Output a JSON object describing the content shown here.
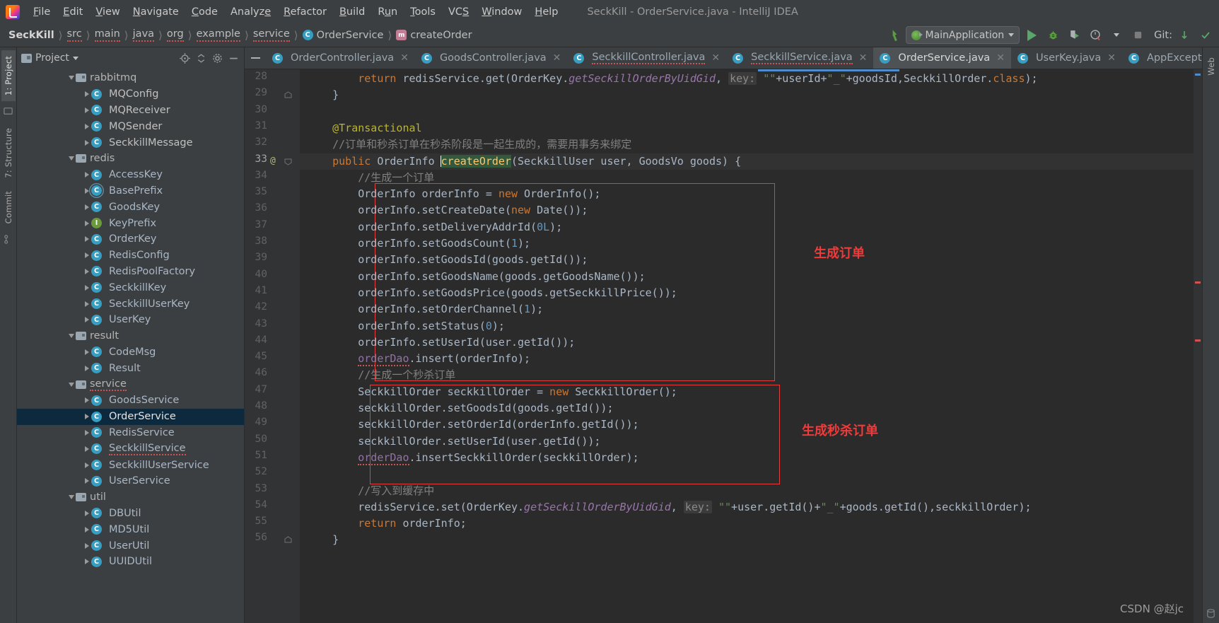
{
  "window": {
    "title": "SeckKill - OrderService.java - IntelliJ IDEA"
  },
  "menu": {
    "items": [
      {
        "label": "File"
      },
      {
        "label": "Edit"
      },
      {
        "label": "View"
      },
      {
        "label": "Navigate"
      },
      {
        "label": "Code"
      },
      {
        "label": "Analyze"
      },
      {
        "label": "Refactor"
      },
      {
        "label": "Build"
      },
      {
        "label": "Run"
      },
      {
        "label": "Tools"
      },
      {
        "label": "VCS"
      },
      {
        "label": "Window"
      },
      {
        "label": "Help"
      }
    ]
  },
  "breadcrumbs": [
    {
      "label": "SeckKill",
      "icon": "",
      "bold": true
    },
    {
      "label": "src",
      "icon": "",
      "squiggle": true
    },
    {
      "label": "main",
      "icon": "",
      "squiggle": true
    },
    {
      "label": "java",
      "icon": "",
      "squiggle": true
    },
    {
      "label": "org",
      "icon": "",
      "squiggle": true
    },
    {
      "label": "example",
      "icon": "",
      "squiggle": true
    },
    {
      "label": "service",
      "icon": "",
      "squiggle": true
    },
    {
      "label": "OrderService",
      "icon": "class-icon",
      "squiggle": false
    },
    {
      "label": "createOrder",
      "icon": "method-icon",
      "squiggle": false
    }
  ],
  "toolbar": {
    "run_configuration": "MainApplication",
    "run_button": "run-button",
    "debug_button": "debug-button",
    "run_coverage_button": "run-with-coverage-button",
    "profiler_button": "profiler-button",
    "stop_button": "stop-button",
    "git_label": "Git:"
  },
  "project_panel": {
    "title": "Project",
    "tree": [
      {
        "indent": 3,
        "arrow": "open",
        "icon": "folder",
        "label": "rabbitmq",
        "style": "folder"
      },
      {
        "indent": 4,
        "arrow": "closed",
        "icon": "class",
        "label": "MQConfig",
        "style": "plain"
      },
      {
        "indent": 4,
        "arrow": "closed",
        "icon": "class",
        "label": "MQReceiver",
        "style": "plain"
      },
      {
        "indent": 4,
        "arrow": "closed",
        "icon": "class",
        "label": "MQSender",
        "style": "plain"
      },
      {
        "indent": 4,
        "arrow": "closed",
        "icon": "class",
        "label": "SeckkillMessage",
        "style": "plain"
      },
      {
        "indent": 3,
        "arrow": "open",
        "icon": "folder",
        "label": "redis",
        "style": "folder"
      },
      {
        "indent": 4,
        "arrow": "closed",
        "icon": "class",
        "label": "AccessKey",
        "style": "code"
      },
      {
        "indent": 4,
        "arrow": "closed",
        "icon": "abstract",
        "label": "BasePrefix",
        "style": "code"
      },
      {
        "indent": 4,
        "arrow": "closed",
        "icon": "class",
        "label": "GoodsKey",
        "style": "code"
      },
      {
        "indent": 4,
        "arrow": "closed",
        "icon": "interface",
        "label": "KeyPrefix",
        "style": "code"
      },
      {
        "indent": 4,
        "arrow": "closed",
        "icon": "class",
        "label": "OrderKey",
        "style": "code"
      },
      {
        "indent": 4,
        "arrow": "closed",
        "icon": "class",
        "label": "RedisConfig",
        "style": "code"
      },
      {
        "indent": 4,
        "arrow": "closed",
        "icon": "class",
        "label": "RedisPoolFactory",
        "style": "code"
      },
      {
        "indent": 4,
        "arrow": "closed",
        "icon": "class",
        "label": "SeckkillKey",
        "style": "code"
      },
      {
        "indent": 4,
        "arrow": "closed",
        "icon": "class",
        "label": "SeckkillUserKey",
        "style": "code"
      },
      {
        "indent": 4,
        "arrow": "closed",
        "icon": "class",
        "label": "UserKey",
        "style": "code"
      },
      {
        "indent": 3,
        "arrow": "open",
        "icon": "folder",
        "label": "result",
        "style": "folder"
      },
      {
        "indent": 4,
        "arrow": "closed",
        "icon": "class",
        "label": "CodeMsg",
        "style": "code"
      },
      {
        "indent": 4,
        "arrow": "closed",
        "icon": "class",
        "label": "Result",
        "style": "code"
      },
      {
        "indent": 3,
        "arrow": "open",
        "icon": "folder",
        "label": "service",
        "style": "folder-squig"
      },
      {
        "indent": 4,
        "arrow": "closed",
        "icon": "class",
        "label": "GoodsService",
        "style": "code"
      },
      {
        "indent": 4,
        "arrow": "closed",
        "icon": "class",
        "label": "OrderService",
        "style": "white",
        "selected": true
      },
      {
        "indent": 4,
        "arrow": "closed",
        "icon": "class",
        "label": "RedisService",
        "style": "code"
      },
      {
        "indent": 4,
        "arrow": "closed",
        "icon": "class",
        "label": "SeckkillService",
        "style": "code-squig"
      },
      {
        "indent": 4,
        "arrow": "closed",
        "icon": "class",
        "label": "SeckkillUserService",
        "style": "code"
      },
      {
        "indent": 4,
        "arrow": "closed",
        "icon": "class",
        "label": "UserService",
        "style": "code"
      },
      {
        "indent": 3,
        "arrow": "open",
        "icon": "folder",
        "label": "util",
        "style": "folder"
      },
      {
        "indent": 4,
        "arrow": "closed",
        "icon": "class",
        "label": "DBUtil",
        "style": "code"
      },
      {
        "indent": 4,
        "arrow": "closed",
        "icon": "class",
        "label": "MD5Util",
        "style": "code"
      },
      {
        "indent": 4,
        "arrow": "closed",
        "icon": "class",
        "label": "UserUtil",
        "style": "code"
      },
      {
        "indent": 4,
        "arrow": "closed",
        "icon": "class",
        "label": "UUIDUtil",
        "style": "code"
      }
    ]
  },
  "left_tool_window_tabs": [
    {
      "label": "1: Project"
    },
    {
      "label": "7: Structure"
    },
    {
      "label": "Commit"
    }
  ],
  "right_tool_window_tabs": [
    {
      "label": "Web"
    }
  ],
  "editor_tabs": [
    {
      "label": "OrderController.java",
      "icon": "class-icon",
      "active": false,
      "squiggle": false
    },
    {
      "label": "GoodsController.java",
      "icon": "class-icon",
      "active": false,
      "squiggle": false
    },
    {
      "label": "SeckkillController.java",
      "icon": "class-icon",
      "active": false,
      "squiggle": true
    },
    {
      "label": "SeckkillService.java",
      "icon": "class-icon",
      "active": false,
      "squiggle": true
    },
    {
      "label": "OrderService.java",
      "icon": "class-icon",
      "active": true,
      "squiggle": false
    },
    {
      "label": "UserKey.java",
      "icon": "class-icon",
      "active": false,
      "squiggle": false
    },
    {
      "label": "AppException",
      "icon": "class-icon",
      "active": false,
      "squiggle": false
    }
  ],
  "code": {
    "first_line_number": 28,
    "current_line_number": 33,
    "lines": [
      {
        "num": 28,
        "html": "        <span class=\"k\">return</span> redisService.get(OrderKey.<span class=\"st\">getSeckillOrderByUidGid</span>, <span class=\"pm\">key:</span> <span class=\"s\">\"\"</span>+userId+<span class=\"s\">\"_\"</span>+goodsId,SeckkillOrder.<span class=\"k\">class</span>);"
      },
      {
        "num": 29,
        "html": "    }"
      },
      {
        "num": 30,
        "html": ""
      },
      {
        "num": 31,
        "html": "    <span class=\"an\">@Transactional</span>"
      },
      {
        "num": 32,
        "html": "    <span class=\"cm\">//订单和秒杀订单在秒杀阶段是一起生成的，需要用事务来绑定</span>"
      },
      {
        "num": 33,
        "html": "    <span class=\"k\">public</span> OrderInfo <span class=\"caret\"></span><span class=\"meth-hl fn\">createOrder</span>(SeckkillUser user, GoodsVo goods) {"
      },
      {
        "num": 34,
        "html": "        <span class=\"cm\">//生成一个订单</span>"
      },
      {
        "num": 35,
        "html": "        OrderInfo orderInfo = <span class=\"k\">new</span> OrderInfo();"
      },
      {
        "num": 36,
        "html": "        orderInfo.setCreateDate(<span class=\"k\">new</span> Date());"
      },
      {
        "num": 37,
        "html": "        orderInfo.setDeliveryAddrId(<span class=\"n\">0L</span>);"
      },
      {
        "num": 38,
        "html": "        orderInfo.setGoodsCount(<span class=\"n\">1</span>);"
      },
      {
        "num": 39,
        "html": "        orderInfo.setGoodsId(goods.getId());"
      },
      {
        "num": 40,
        "html": "        orderInfo.setGoodsName(goods.getGoodsName());"
      },
      {
        "num": 41,
        "html": "        orderInfo.setGoodsPrice(goods.getSeckkillPrice());"
      },
      {
        "num": 42,
        "html": "        orderInfo.setOrderChannel(<span class=\"n\">1</span>);"
      },
      {
        "num": 43,
        "html": "        orderInfo.setStatus(<span class=\"n\">0</span>);"
      },
      {
        "num": 44,
        "html": "        orderInfo.setUserId(user.getId());"
      },
      {
        "num": 45,
        "html": "        <span class=\"fi err-sq\">orderDao</span>.insert(orderInfo);"
      },
      {
        "num": 46,
        "html": "        <span class=\"cm\">//生成一个秒杀订单</span>"
      },
      {
        "num": 47,
        "html": "        SeckkillOrder seckkillOrder = <span class=\"k\">new</span> SeckkillOrder();"
      },
      {
        "num": 48,
        "html": "        seckkillOrder.setGoodsId(goods.getId());"
      },
      {
        "num": 49,
        "html": "        seckkillOrder.setOrderId(orderInfo.getId());"
      },
      {
        "num": 50,
        "html": "        seckkillOrder.setUserId(user.getId());"
      },
      {
        "num": 51,
        "html": "        <span class=\"fi err-sq\">orderDao</span>.insertSeckkillOrder(seckkillOrder);"
      },
      {
        "num": 52,
        "html": ""
      },
      {
        "num": 53,
        "html": "        <span class=\"cm\">//写入到缓存中</span>"
      },
      {
        "num": 54,
        "html": "        redisService.set(OrderKey.<span class=\"st\">getSeckillOrderByUidGid</span>, <span class=\"pm\">key:</span> <span class=\"s\">\"\"</span>+user.getId()+<span class=\"s\">\"_\"</span>+goods.getId(),seckkillOrder);"
      },
      {
        "num": 55,
        "html": "        <span class=\"k\">return</span> orderInfo;"
      },
      {
        "num": 56,
        "html": "    }"
      }
    ]
  },
  "annotations": [
    {
      "label": "生成订单",
      "color": "#ee3b3b"
    },
    {
      "label": "生成秒杀订单",
      "color": "#ee3b3b"
    }
  ],
  "watermark": "CSDN @赵jc",
  "colors": {
    "background": "#2b2b2b",
    "panel": "#3c3f41",
    "accent": "#4f8ccc",
    "annotation_red": "#e33e3e",
    "selection": "#0d293e"
  }
}
